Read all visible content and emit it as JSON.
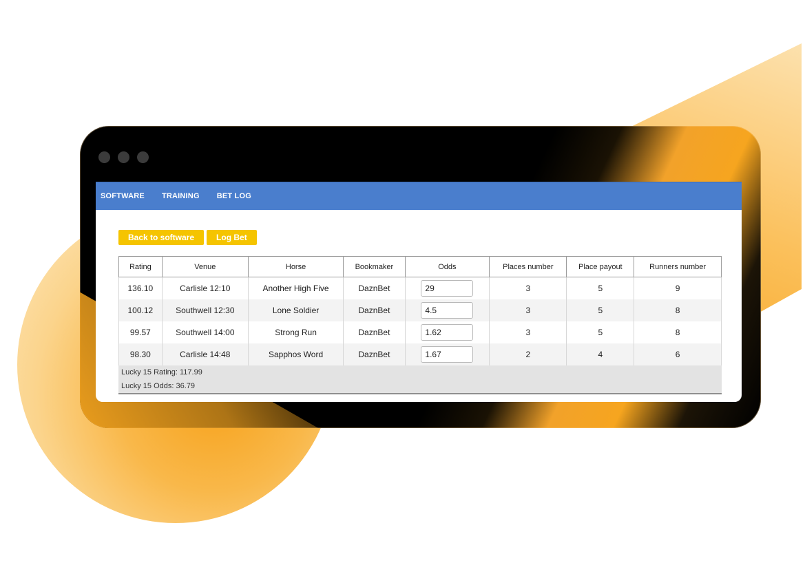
{
  "nav": {
    "items": [
      "SOFTWARE",
      "TRAINING",
      "BET LOG"
    ]
  },
  "toolbar": {
    "back_label": "Back to software",
    "log_label": "Log Bet"
  },
  "table": {
    "headers": [
      "Rating",
      "Venue",
      "Horse",
      "Bookmaker",
      "Odds",
      "Places number",
      "Place payout",
      "Runners number"
    ],
    "rows": [
      {
        "rating": "136.10",
        "venue": "Carlisle 12:10",
        "horse": "Another High Five",
        "bookmaker": "DaznBet",
        "odds": "29",
        "places": "3",
        "payout": "5",
        "runners": "9"
      },
      {
        "rating": "100.12",
        "venue": "Southwell 12:30",
        "horse": "Lone Soldier",
        "bookmaker": "DaznBet",
        "odds": "4.5",
        "places": "3",
        "payout": "5",
        "runners": "8"
      },
      {
        "rating": "99.57",
        "venue": "Southwell 14:00",
        "horse": "Strong Run",
        "bookmaker": "DaznBet",
        "odds": "1.62",
        "places": "3",
        "payout": "5",
        "runners": "8"
      },
      {
        "rating": "98.30",
        "venue": "Carlisle 14:48",
        "horse": "Sapphos Word",
        "bookmaker": "DaznBet",
        "odds": "1.67",
        "places": "2",
        "payout": "4",
        "runners": "6"
      }
    ]
  },
  "summary": {
    "rating": "Lucky 15 Rating: 117.99",
    "odds": "Lucky 15 Odds: 36.79"
  },
  "colors": {
    "nav_bg": "#4a7ecd",
    "button_bg": "#f5c400",
    "accent_orange": "#f7a21b"
  }
}
